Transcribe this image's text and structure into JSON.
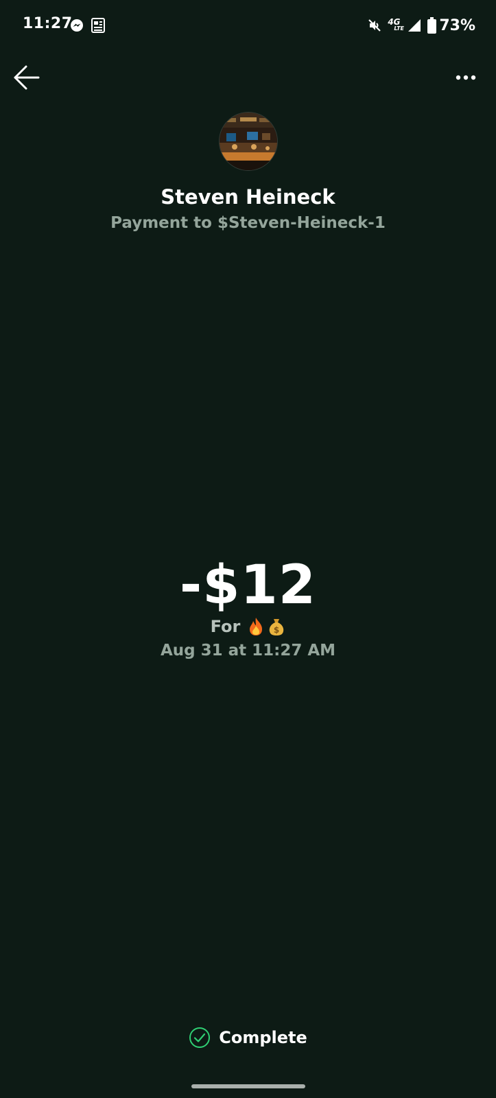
{
  "status_bar": {
    "time": "11:27",
    "network": "4G",
    "network_sub": "LTE",
    "battery_percent": "73%",
    "icons": [
      "messenger-icon",
      "news-icon",
      "mute-icon",
      "signal-icon",
      "battery-icon"
    ]
  },
  "nav": {
    "back_icon": "arrow-left-icon",
    "more_icon": "more-horizontal-icon"
  },
  "payment": {
    "name": "Steven Heineck",
    "subtitle": "Payment to $Steven-Heineck-1",
    "amount": "-$12",
    "memo_label": "For",
    "memo_emoji": [
      "fire-icon",
      "money-bag-icon"
    ],
    "date": "Aug 31 at 11:27 AM",
    "status": "Complete"
  },
  "colors": {
    "background": "#0d1b15",
    "secondary_text": "#94a59b",
    "success": "#2fcf73"
  }
}
